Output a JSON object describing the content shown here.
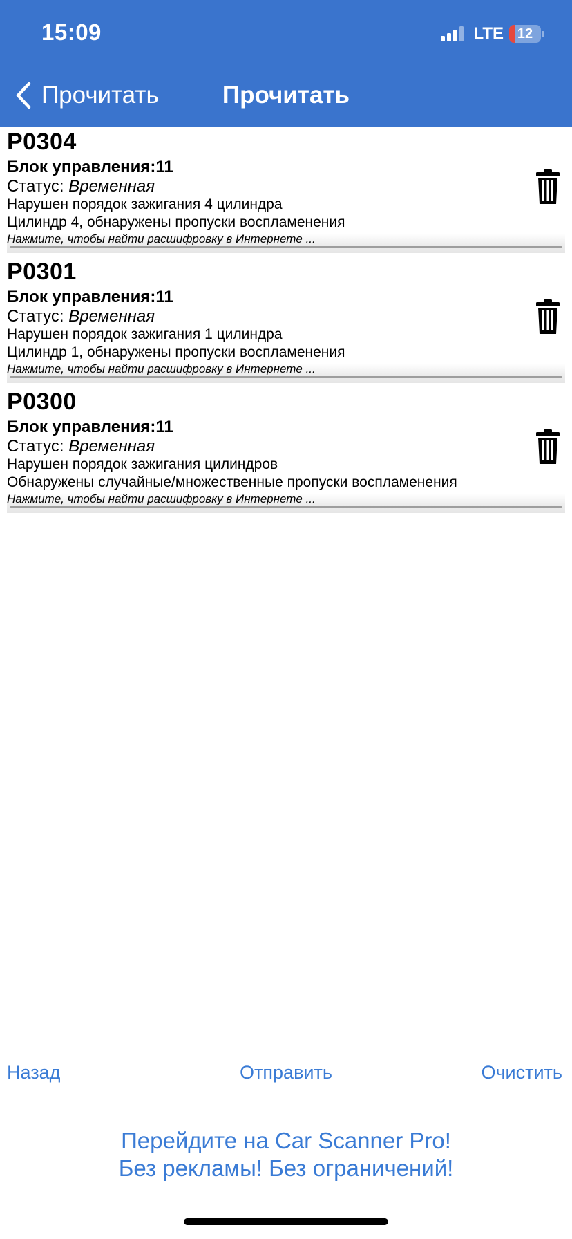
{
  "status_bar": {
    "time": "15:09",
    "network": "LTE",
    "battery": "12"
  },
  "nav": {
    "back_label": "Прочитать",
    "title": "Прочитать"
  },
  "errors": [
    {
      "code": "P0304",
      "unit": "Блок управления:11",
      "status_prefix": "Статус:",
      "status_value": "Временная",
      "description_1": "Нарушен порядок зажигания 4 цилиндра",
      "description_2": "Цилиндр 4, обнаружены пропуски воспламенения",
      "hint": "Нажмите, чтобы найти расшифровку в Интернете ..."
    },
    {
      "code": "P0301",
      "unit": "Блок управления:11",
      "status_prefix": "Статус:",
      "status_value": "Временная",
      "description_1": "Нарушен порядок зажигания 1 цилиндра",
      "description_2": "Цилиндр 1, обнаружены пропуски воспламенения",
      "hint": "Нажмите, чтобы найти расшифровку в Интернете ..."
    },
    {
      "code": "P0300",
      "unit": "Блок управления:11",
      "status_prefix": "Статус:",
      "status_value": "Временная",
      "description_1": "Нарушен порядок зажигания цилиндров",
      "description_2": "Обнаружены случайные/множественные пропуски воспламенения",
      "hint": "Нажмите, чтобы найти расшифровку в Интернете ..."
    }
  ],
  "actions": {
    "back": "Назад",
    "send": "Отправить",
    "clear": "Очистить"
  },
  "promo": {
    "line1": "Перейдите на Car Scanner Pro!",
    "line2": "Без рекламы! Без ограничений!"
  },
  "colors": {
    "header_bg": "#3a74cd",
    "link": "#3a7bd5",
    "battery_low": "#e5483e"
  },
  "icons": {
    "back": "chevron-left-icon",
    "delete": "trash-icon",
    "signal": "cellular-signal-icon",
    "battery": "battery-icon"
  }
}
